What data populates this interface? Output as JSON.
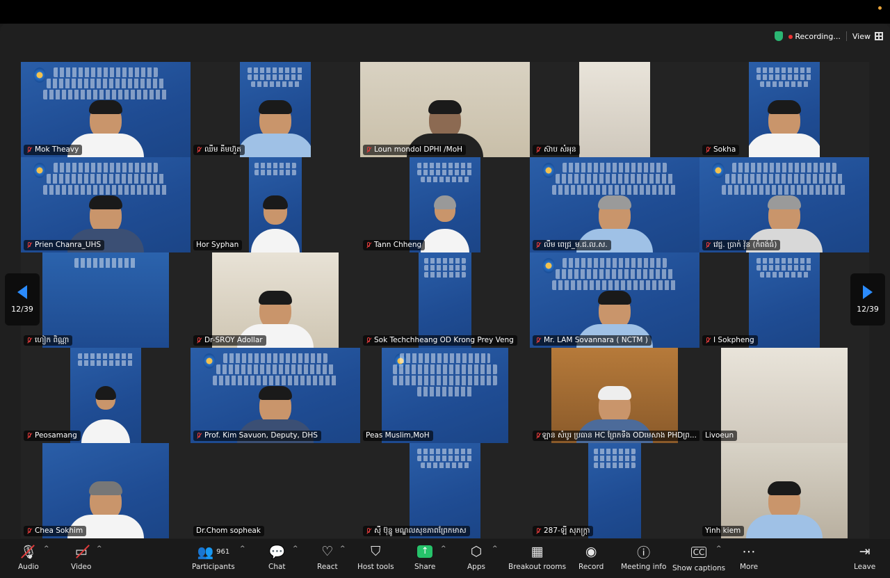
{
  "status": {
    "recording_label": "Recording...",
    "view_label": "View"
  },
  "pager": {
    "left": "12/39",
    "right": "12/39"
  },
  "participants": [
    "Mok Theavy",
    "ឈឹម គឹមហ៊ួត",
    "Loun mondol DPHI /MoH",
    "ស៊ាប សំអុន",
    "Sokha",
    "Prien Chanra_UHS",
    "Hor Syphan",
    "Tann Chheng",
    "លឹម ពេជ្រ_ម.ជ.ល.ស.",
    "វេជ្ជ. ប្រាក់ វ៉ុន (កំពង់ធំ)",
    "ហៀក ពិណ្ណា",
    "Dr-SROY Adollar",
    "Sok Techchheang OD Krong Prey Veng",
    "Mr. LAM Sovannara ( NCTM )",
    "I Sokpheng",
    "Peosamang",
    "Prof. Kim Savuon, Deputy, DHS",
    "Peas Muslim,MoH",
    "ឡាន សំបូរ ប្រធាន HC ព្រែកទឹង ODមេសាង PHDព្រ...",
    "Livoeun",
    "Chea Sokhim",
    "Dr.Chom sopheak",
    "ស៊ឺ ប៊ុន្នូ មណ្ឌលសុខភាពព្រែកមាស",
    "287-ឡី សុភក្ត្រា",
    "Yinh kiem"
  ],
  "toolbar": {
    "audio": "Audio",
    "video": "Video",
    "participants": "Participants",
    "participants_count": "961",
    "chat": "Chat",
    "react": "React",
    "host_tools": "Host tools",
    "share": "Share",
    "apps": "Apps",
    "breakout": "Breakout rooms",
    "record": "Record",
    "meeting_info": "Meeting info",
    "captions": "Show captions",
    "more": "More",
    "leave": "Leave"
  }
}
